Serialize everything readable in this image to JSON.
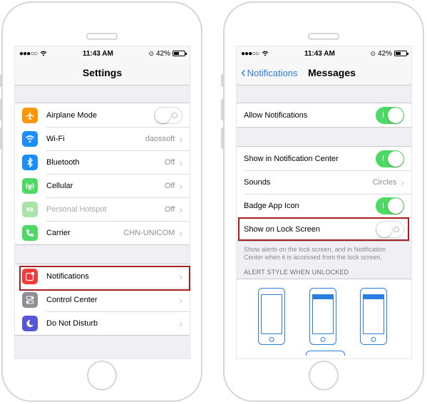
{
  "status": {
    "time": "11:43 AM",
    "battery": "42%"
  },
  "settings": {
    "title": "Settings",
    "group1": [
      {
        "label": "Airplane Mode",
        "icon": "airplane-icon",
        "color": "#ff9500",
        "control": "toggle-off"
      },
      {
        "label": "Wi-Fi",
        "icon": "wifi-icon",
        "color": "#1c8efb",
        "value": "daossoft"
      },
      {
        "label": "Bluetooth",
        "icon": "bluetooth-icon",
        "color": "#1c8efb",
        "value": "Off"
      },
      {
        "label": "Cellular",
        "icon": "cellular-icon",
        "color": "#4cd964",
        "value": "Off"
      },
      {
        "label": "Personal Hotspot",
        "icon": "hotspot-icon",
        "color": "#a8e3a8",
        "value": "Off",
        "disabled": true
      },
      {
        "label": "Carrier",
        "icon": "phone-icon",
        "color": "#4cd964",
        "value": "CHN-UNICOM"
      }
    ],
    "group2": [
      {
        "label": "Notifications",
        "icon": "notifications-icon",
        "color": "#f23a3a"
      },
      {
        "label": "Control Center",
        "icon": "control-center-icon",
        "color": "#8e8e93"
      },
      {
        "label": "Do Not Disturb",
        "icon": "moon-icon",
        "color": "#5856d6"
      }
    ]
  },
  "messages": {
    "back_label": "Notifications",
    "title": "Messages",
    "allow_notifications": "Allow Notifications",
    "show_in_center": "Show in Notification Center",
    "sounds": "Sounds",
    "sounds_value": "Circles",
    "badge": "Badge App Icon",
    "lock_screen": "Show on Lock Screen",
    "footnote": "Show alerts on the lock screen, and in Notification Center when it is accessed from the lock screen.",
    "alert_header": "ALERT STYLE WHEN UNLOCKED"
  },
  "colors": {
    "accent": "#2a7ee0",
    "toggle_on": "#4cd964",
    "highlight": "#a31f24"
  }
}
